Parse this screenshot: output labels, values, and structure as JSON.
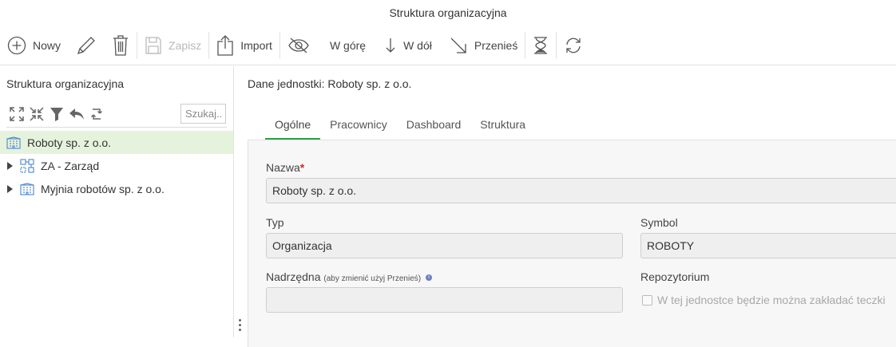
{
  "window": {
    "title": "Struktura organizacyjna"
  },
  "toolbar": {
    "new_label": "Nowy",
    "save_label": "Zapisz",
    "import_label": "Import",
    "up_label": "W górę",
    "down_label": "W dół",
    "move_label": "Przenieś",
    "icons": [
      "plus-circle-icon",
      "pencil-icon",
      "trash-icon",
      "floppy-icon",
      "upload-icon",
      "eye-off-icon",
      "arrow-down-icon",
      "arrow-down-right-icon",
      "hourglass-icon",
      "refresh-icon"
    ]
  },
  "left": {
    "title": "Struktura organizacyjna",
    "search_placeholder": "Szukaj..",
    "tree": [
      {
        "label": "Roboty sp. z o.o.",
        "icon": "building-icon",
        "selected": true
      },
      {
        "label": "ZA - Zarząd",
        "icon": "org-chart-icon",
        "selected": false
      },
      {
        "label": "Myjnia robotów sp. z o.o.",
        "icon": "building-icon",
        "selected": false
      }
    ]
  },
  "details": {
    "title": "Dane jednostki: Roboty sp. z o.o.",
    "tabs": [
      "Ogólne",
      "Pracownicy",
      "Dashboard",
      "Struktura"
    ],
    "active_tab": "Ogólne",
    "form": {
      "name_label": "Nazwa",
      "name_required_mark": "*",
      "name_value": "Roboty sp. z o.o.",
      "type_label": "Typ",
      "type_value": "Organizacja",
      "symbol_label": "Symbol",
      "symbol_value": "ROBOTY",
      "parent_label": "Nadrzędna",
      "parent_hint": "(aby zmienić użyj Przenieś)",
      "parent_info": "i",
      "parent_value": "",
      "repo_label": "Repozytorium",
      "repo_checkbox_label": "W tej jednostce będzie można zakładać teczki",
      "repo_checked": false
    }
  },
  "colors": {
    "accent": "#2e9e4e",
    "selected_row": "#e6f3dc",
    "tree_icon": "#5a8fd0",
    "required": "#d9261c"
  }
}
